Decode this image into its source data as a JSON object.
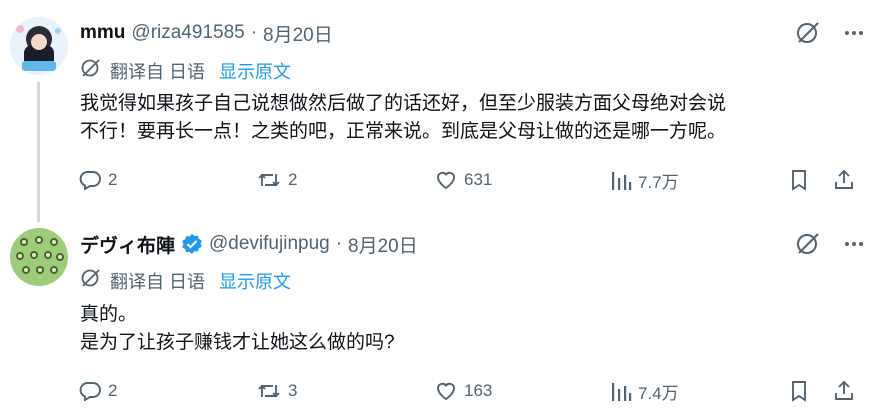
{
  "tweets": [
    {
      "author": {
        "name": "mmu",
        "handle": "@riza491585",
        "separator": "·",
        "date": "8月20日"
      },
      "translate": {
        "label": "翻译自 日语",
        "show_original": "显示原文"
      },
      "text_lines": [
        "我觉得如果孩子自己说想做然后做了的话还好，但至少服装方面父母绝对会说",
        "不行！要再长一点！之类的吧，正常来说。到底是父母让做的还是哪一方呢。"
      ],
      "stats": {
        "replies": "2",
        "reposts": "2",
        "likes": "631",
        "views": "7.7万"
      }
    },
    {
      "author": {
        "name": "デヴィ布陣",
        "handle": "@devifujinpug",
        "separator": "·",
        "date": "8月20日",
        "verified": true
      },
      "translate": {
        "label": "翻译自 日语",
        "show_original": "显示原文"
      },
      "text_lines": [
        "真的。",
        "是为了让孩子赚钱才让她这么做的吗?"
      ],
      "stats": {
        "replies": "2",
        "reposts": "3",
        "likes": "163",
        "views": "7.4万"
      }
    }
  ],
  "colors": {
    "text": "#0f1419",
    "muted": "#536471",
    "accent": "#1d9bf0",
    "thread_line": "#cfd9de"
  },
  "icons": [
    "grok-icon",
    "more-icon",
    "translate-icon",
    "reply-icon",
    "repost-icon",
    "like-icon",
    "views-icon",
    "bookmark-icon",
    "share-icon",
    "verified-badge-icon"
  ]
}
